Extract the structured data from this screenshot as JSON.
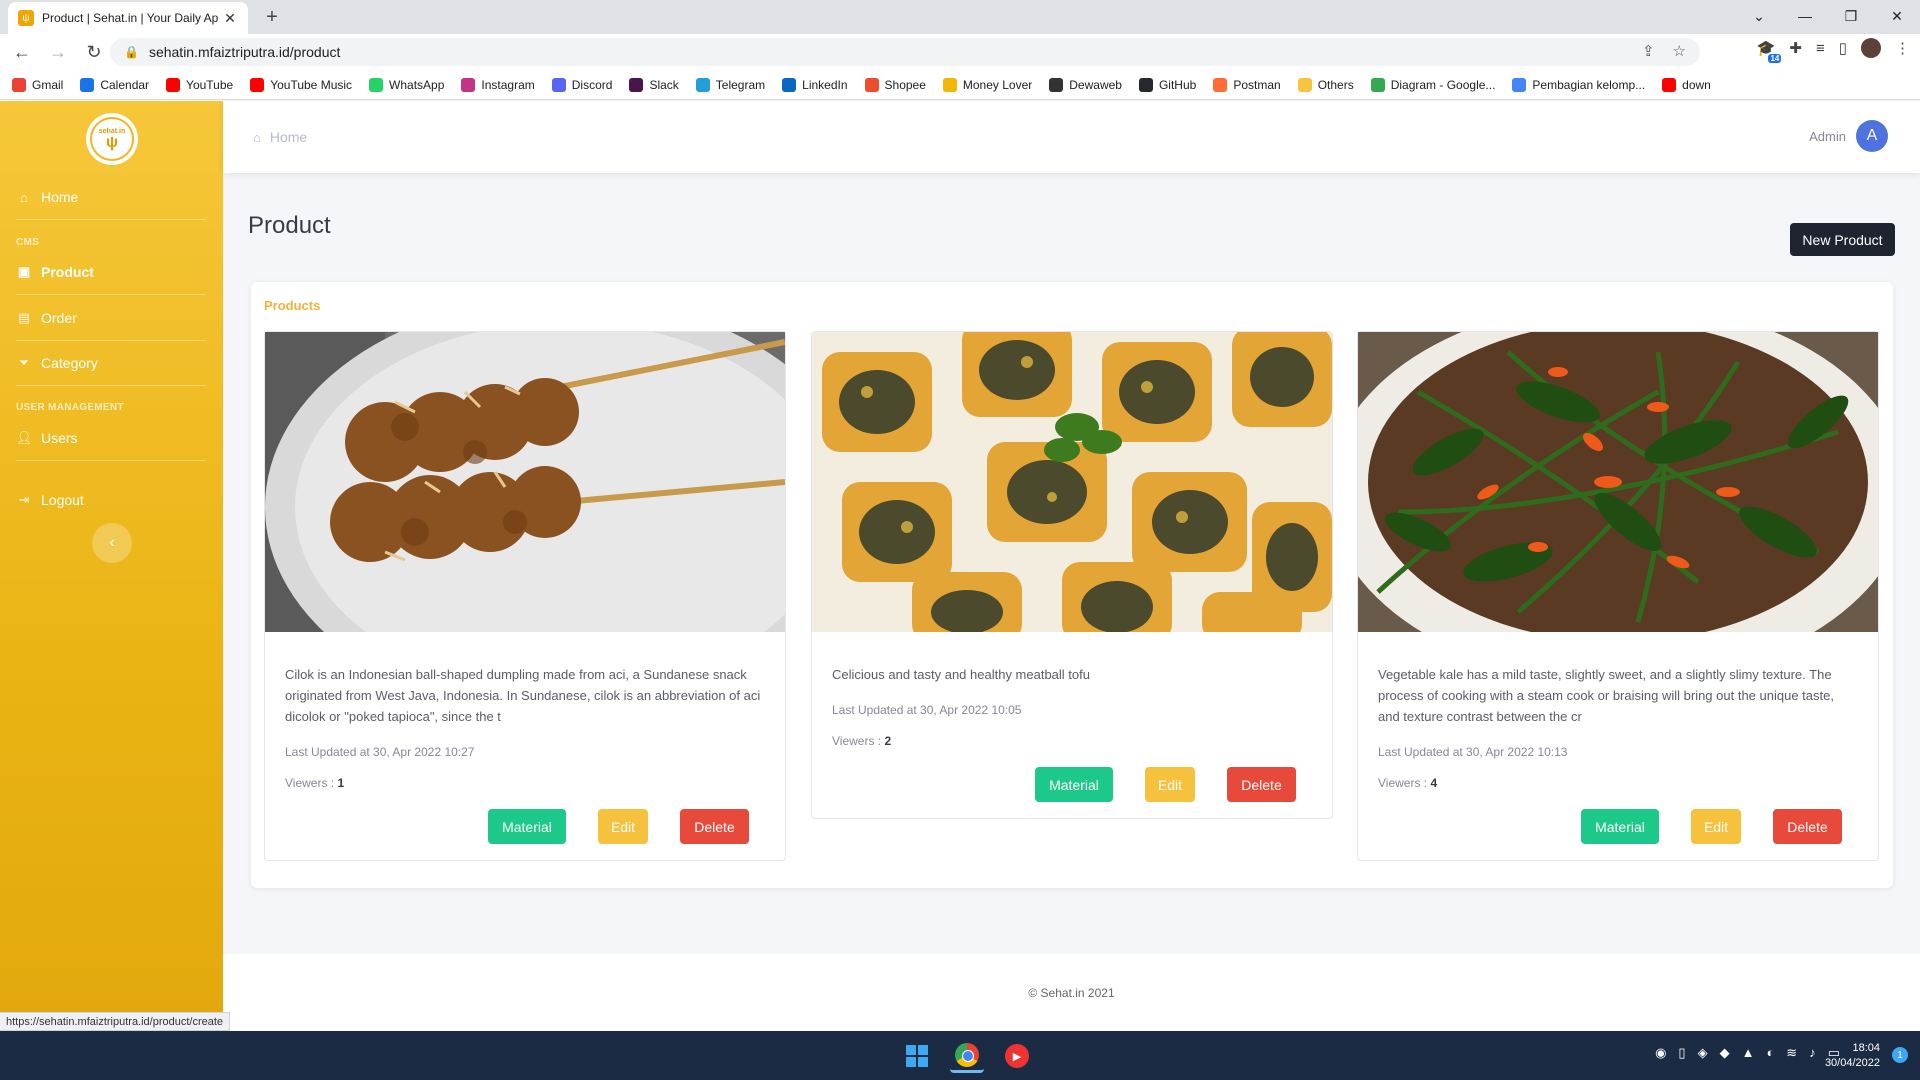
{
  "browser": {
    "tab_title": "Product | Sehat.in | Your Daily Ap",
    "url": "sehatin.mfaiztriputra.id/product",
    "bookmarks": [
      {
        "label": "Gmail",
        "color": "#ea4335"
      },
      {
        "label": "Calendar",
        "color": "#1a73e8"
      },
      {
        "label": "YouTube",
        "color": "#ff0000"
      },
      {
        "label": "YouTube Music",
        "color": "#ff0000"
      },
      {
        "label": "WhatsApp",
        "color": "#25d366"
      },
      {
        "label": "Instagram",
        "color": "#c13584"
      },
      {
        "label": "Discord",
        "color": "#5865f2"
      },
      {
        "label": "Slack",
        "color": "#4a154b"
      },
      {
        "label": "Telegram",
        "color": "#229ed9"
      },
      {
        "label": "LinkedIn",
        "color": "#0a66c2"
      },
      {
        "label": "Shopee",
        "color": "#ee4d2d"
      },
      {
        "label": "Money Lover",
        "color": "#f2b705"
      },
      {
        "label": "Dewaweb",
        "color": "#333333"
      },
      {
        "label": "GitHub",
        "color": "#24292e"
      },
      {
        "label": "Postman",
        "color": "#ff6c37"
      },
      {
        "label": "Others",
        "color": "#f5c542"
      },
      {
        "label": "Diagram - Google...",
        "color": "#34a853"
      },
      {
        "label": "Pembagian kelomp...",
        "color": "#4285f4"
      },
      {
        "label": "down",
        "color": "#ff0000"
      }
    ],
    "status_url": "https://sehatin.mfaiztriputra.id/product/create"
  },
  "sidebar": {
    "logo_text": "sehat.in",
    "home": "Home",
    "cms_heading": "CMS",
    "product": "Product",
    "order": "Order",
    "category": "Category",
    "user_heading": "USER MANAGEMENT",
    "users": "Users",
    "logout": "Logout"
  },
  "topbar": {
    "breadcrumb": "Home",
    "user_name": "Admin",
    "user_initial": "A"
  },
  "page": {
    "title": "Product",
    "new_button": "New Product",
    "panel_title": "Products"
  },
  "products": [
    {
      "description": "Cilok is an Indonesian ball-shaped dumpling made from aci, a Sundanese snack originated from West Java, Indonesia. In Sundanese, cilok is an abbreviation of aci dicolok or \"poked tapioca\", since the t",
      "updated": "Last Updated at 30, Apr 2022 10:27",
      "viewers_label": "Viewers : ",
      "viewers": "1",
      "material": "Material",
      "edit": "Edit",
      "delete": "Delete"
    },
    {
      "description": "Celicious and tasty and healthy meatball tofu",
      "updated": "Last Updated at 30, Apr 2022 10:05",
      "viewers_label": "Viewers : ",
      "viewers": "2",
      "material": "Material",
      "edit": "Edit",
      "delete": "Delete"
    },
    {
      "description": "Vegetable kale has a mild taste, slightly sweet, and a slightly slimy texture. The process of cooking with a steam cook or braising will bring out the unique taste, and texture contrast between the cr",
      "updated": "Last Updated at 30, Apr 2022 10:13",
      "viewers_label": "Viewers : ",
      "viewers": "4",
      "material": "Material",
      "edit": "Edit",
      "delete": "Delete"
    }
  ],
  "footer": "© Sehat.in 2021",
  "taskbar": {
    "time": "18:04",
    "date": "30/04/2022",
    "notifications": "1"
  },
  "colors": {
    "sidebar": "#f0bb22",
    "accent_products": "#f0b33a",
    "material": "#1cc88a",
    "edit": "#f6c23e",
    "delete": "#e74a3b",
    "avatar": "#4e73df"
  }
}
